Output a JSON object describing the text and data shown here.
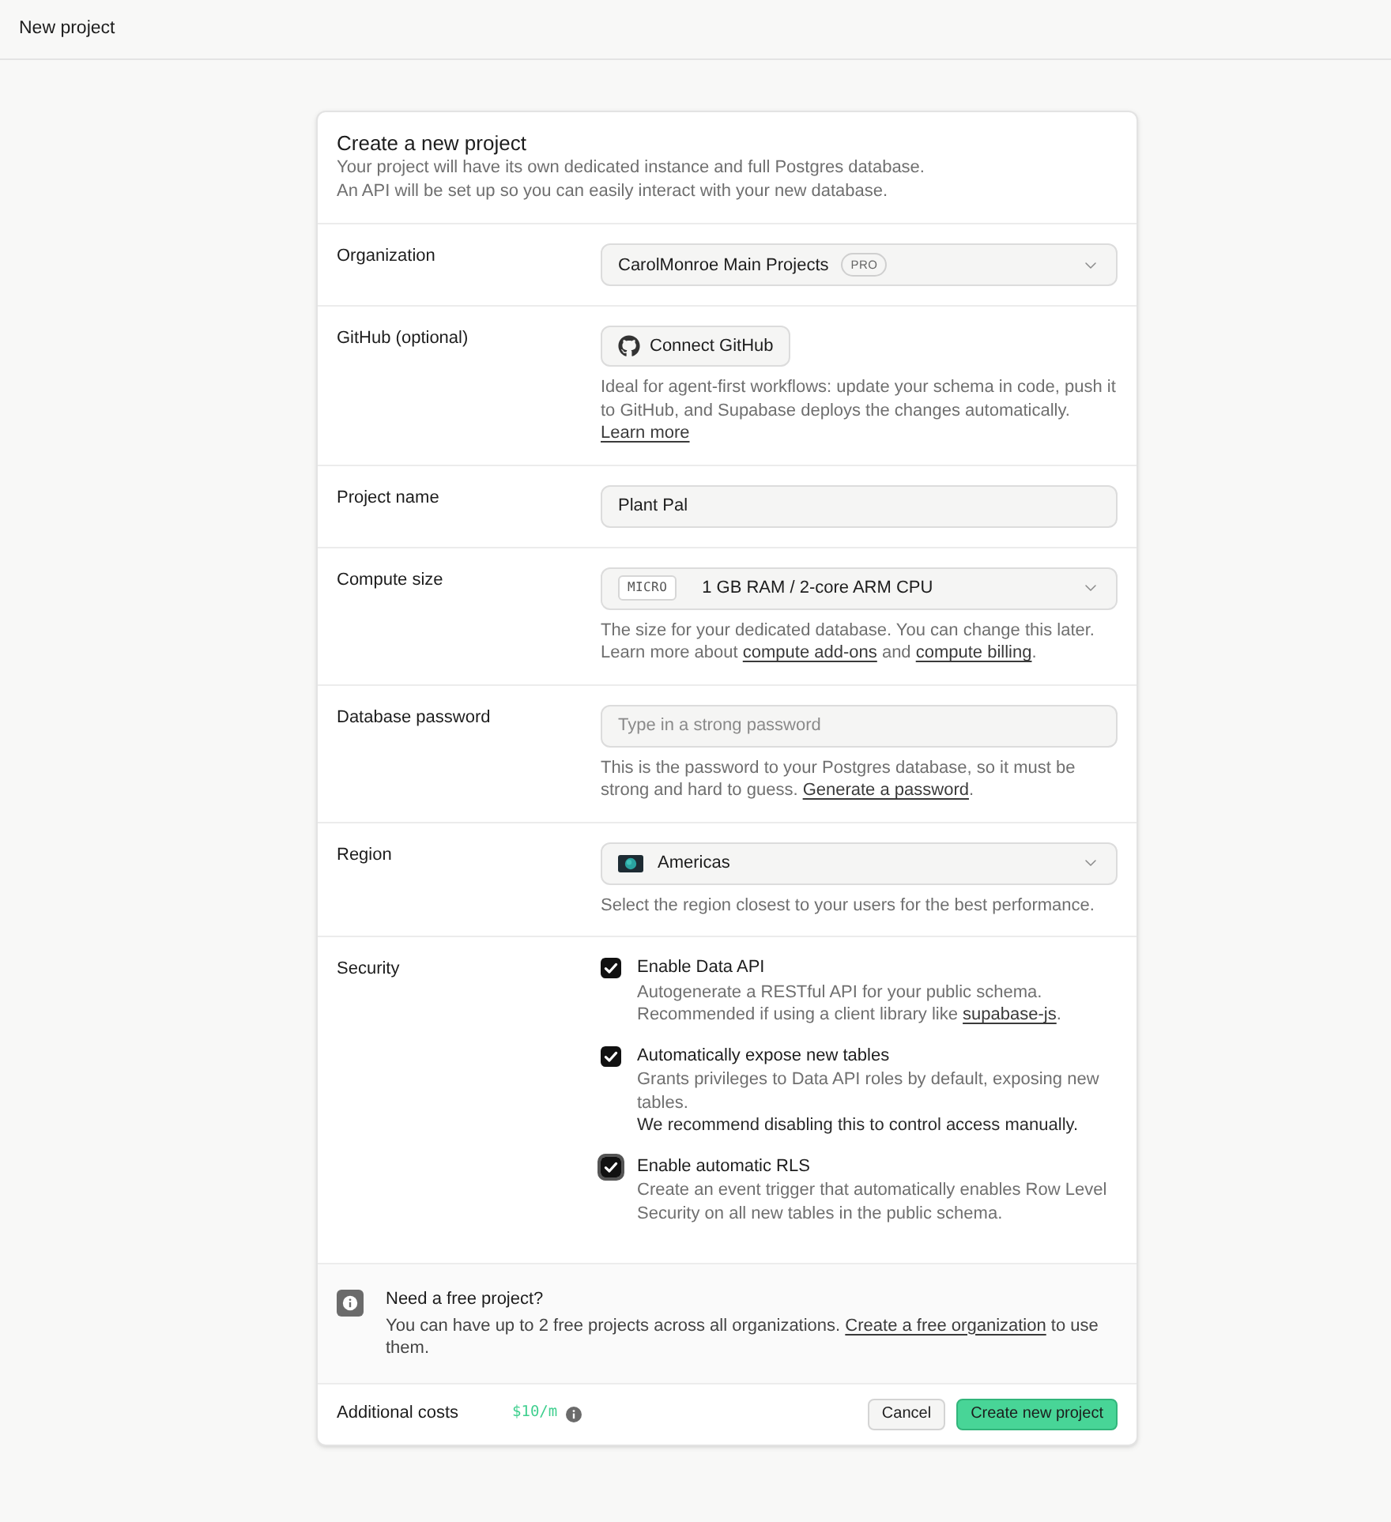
{
  "top_bar": {
    "title": "New project"
  },
  "header": {
    "title": "Create a new project",
    "description": [
      "Your project will have its own dedicated instance and full Postgres database.",
      "An API will be set up so you can easily interact with your new database."
    ]
  },
  "fields": [
    {
      "kind": "select",
      "label": "Organization",
      "value": "CarolMonroe Main Projects",
      "badge": "PRO"
    },
    {
      "kind": "button",
      "label": "GitHub (optional)",
      "button": "Connect GitHub",
      "help": [
        {
          "kind": "text",
          "text": "Ideal for agent-first workflows: update your schema in code, push it to GitHub, and Supabase deploys the changes automatically. "
        },
        {
          "kind": "link",
          "text": "Learn more"
        }
      ]
    },
    {
      "kind": "input",
      "label": "Project name",
      "value": "Plant Pal"
    },
    {
      "kind": "select",
      "label": "Compute size",
      "tag": "MICRO",
      "value": "1 GB RAM / 2-core ARM CPU",
      "help": [
        {
          "kind": "text",
          "text": "The size for your dedicated database. You can change this later. Learn more about "
        },
        {
          "kind": "link",
          "text": "compute add-ons"
        },
        {
          "kind": "text",
          "text": " and "
        },
        {
          "kind": "link",
          "text": "compute billing"
        },
        {
          "kind": "text",
          "text": "."
        }
      ]
    },
    {
      "kind": "input",
      "label": "Database password",
      "placeholder": "Type in a strong password",
      "help": [
        {
          "kind": "text",
          "text": "This is the password to your Postgres database, so it must be strong and hard to guess. "
        },
        {
          "kind": "link",
          "text": "Generate a password"
        },
        {
          "kind": "text",
          "text": "."
        }
      ]
    },
    {
      "kind": "region",
      "label": "Region",
      "value": "Americas",
      "help": [
        {
          "kind": "text",
          "text": "Select the region closest to your users for the best performance."
        }
      ]
    },
    {
      "kind": "checkboxes",
      "label": "Security",
      "options": [
        {
          "label": "Enable Data API",
          "checked": true,
          "focused": false,
          "description": [
            {
              "kind": "text",
              "text": "Autogenerate a RESTful API for your public schema. Recommended if using a client library like "
            },
            {
              "kind": "link",
              "text": "supabase-js"
            },
            {
              "kind": "text",
              "text": "."
            }
          ]
        },
        {
          "label": "Automatically expose new tables",
          "checked": true,
          "focused": false,
          "description": [
            {
              "kind": "text",
              "text": "Grants privileges to Data API roles by default, exposing new tables."
            }
          ],
          "note": "We recommend disabling this to control access manually."
        },
        {
          "label": "Enable automatic RLS",
          "checked": true,
          "focused": true,
          "description": [
            {
              "kind": "text",
              "text": "Create an event trigger that automatically enables Row Level Security on all new tables in the public schema."
            }
          ]
        }
      ]
    }
  ],
  "notice": {
    "title": "Need a free project?",
    "text": [
      {
        "kind": "text",
        "text": "You can have up to 2 free projects across all organizations. "
      },
      {
        "kind": "link",
        "text": "Create a free organization"
      },
      {
        "kind": "text",
        "text": " to use them."
      }
    ]
  },
  "footer": {
    "label": "Additional costs",
    "cost": "$10/m",
    "buttons": [
      {
        "kind": "secondary",
        "label": "Cancel"
      },
      {
        "kind": "primary",
        "label": "Create new project"
      }
    ]
  }
}
